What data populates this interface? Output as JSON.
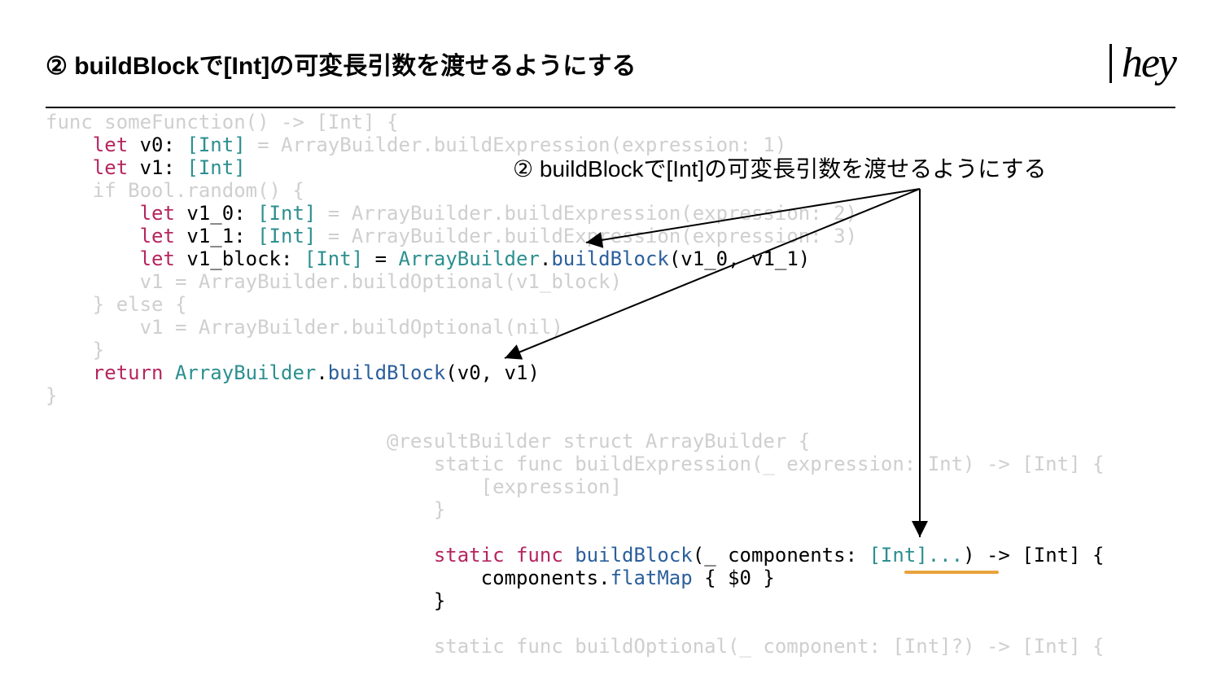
{
  "title": "② buildBlockで[Int]の可変長引数を渡せるようにする",
  "logo": "hey",
  "annotation": "② buildBlockで[Int]の可変長引数を渡せるようにする",
  "code": {
    "l1_dim": "func someFunction() -> [Int] {",
    "l2_let": "    let",
    "l2_v0": " v0: ",
    "l2_int": "[Int]",
    "l2_dim": " = ArrayBuilder.buildExpression(expression: 1)",
    "l3_let": "    let",
    "l3_v1": " v1: ",
    "l3_int": "[Int]",
    "l4_dim": "    if Bool.random() {",
    "l5_let": "        let",
    "l5_v": " v1_0: ",
    "l5_int": "[Int]",
    "l5_dim": " = ArrayBuilder.buildExpression(expression: 2)",
    "l6_let": "        let",
    "l6_v": " v1_1: ",
    "l6_int": "[Int]",
    "l6_dim": " = ArrayBuilder.buildExpression(expression: 3)",
    "l7_let": "        let",
    "l7_v": " v1_block: ",
    "l7_int": "[Int]",
    "l7_eq": " = ",
    "l7_ab": "ArrayBuilder",
    "l7_dot": ".",
    "l7_bb": "buildBlock",
    "l7_args": "(v1_0, v1_1)",
    "l8_dim": "        v1 = ArrayBuilder.buildOptional(v1_block)",
    "l9_dim": "    } else {",
    "l10_dim": "        v1 = ArrayBuilder.buildOptional(nil)",
    "l11_dim": "    }",
    "l12_ret": "    return",
    "l12_sp": " ",
    "l12_ab": "ArrayBuilder",
    "l12_dot": ".",
    "l12_bb": "buildBlock",
    "l12_args": "(v0, v1)",
    "l13_dim": "}",
    "b1_dim": "                             @resultBuilder struct ArrayBuilder {",
    "b2_dim": "                                 static func buildExpression(_ expression: Int) -> [Int] {",
    "b3_dim": "                                     [expression]",
    "b4_dim": "                                 }",
    "b5": "",
    "b6_indent": "                                 ",
    "b6_static": "static",
    "b6_sp": " ",
    "b6_func": "func",
    "b6_sp2": " ",
    "b6_bb": "buildBlock",
    "b6_paren": "(",
    "b6_us": "_",
    "b6_comp": " components: ",
    "b6_type": "[Int]...",
    "b6_close": ") -> [Int] {",
    "b7_indent": "                                     components.",
    "b7_fm": "flatMap",
    "b7_cl": " { $0 }",
    "b8": "                                 }",
    "b9": "",
    "b10_dim": "                                 static func buildOptional(_ component: [Int]?) -> [Int] {"
  }
}
